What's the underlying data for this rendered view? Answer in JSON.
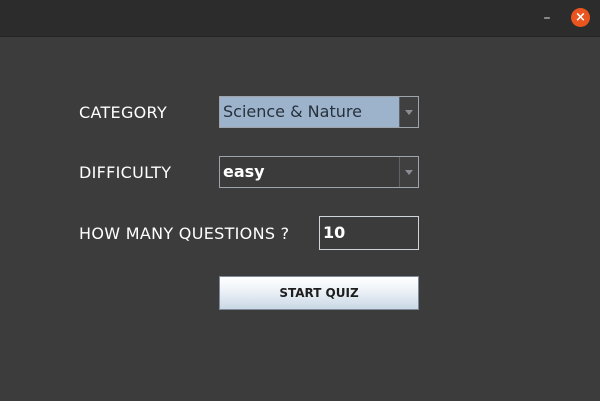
{
  "window": {
    "minimize_label": "–",
    "close_label": "×",
    "close_color": "#e9541f"
  },
  "form": {
    "category": {
      "label": "CATEGORY",
      "selected": "Science & Nature"
    },
    "difficulty": {
      "label": "DIFFICULTY",
      "selected": "easy"
    },
    "questions": {
      "label": "HOW MANY QUESTIONS ?",
      "value": "10"
    },
    "start_button_label": "START QUIZ"
  },
  "colors": {
    "background": "#3c3c3c",
    "titlebar": "#2c2c2c",
    "selection_highlight": "#9db3cc"
  }
}
